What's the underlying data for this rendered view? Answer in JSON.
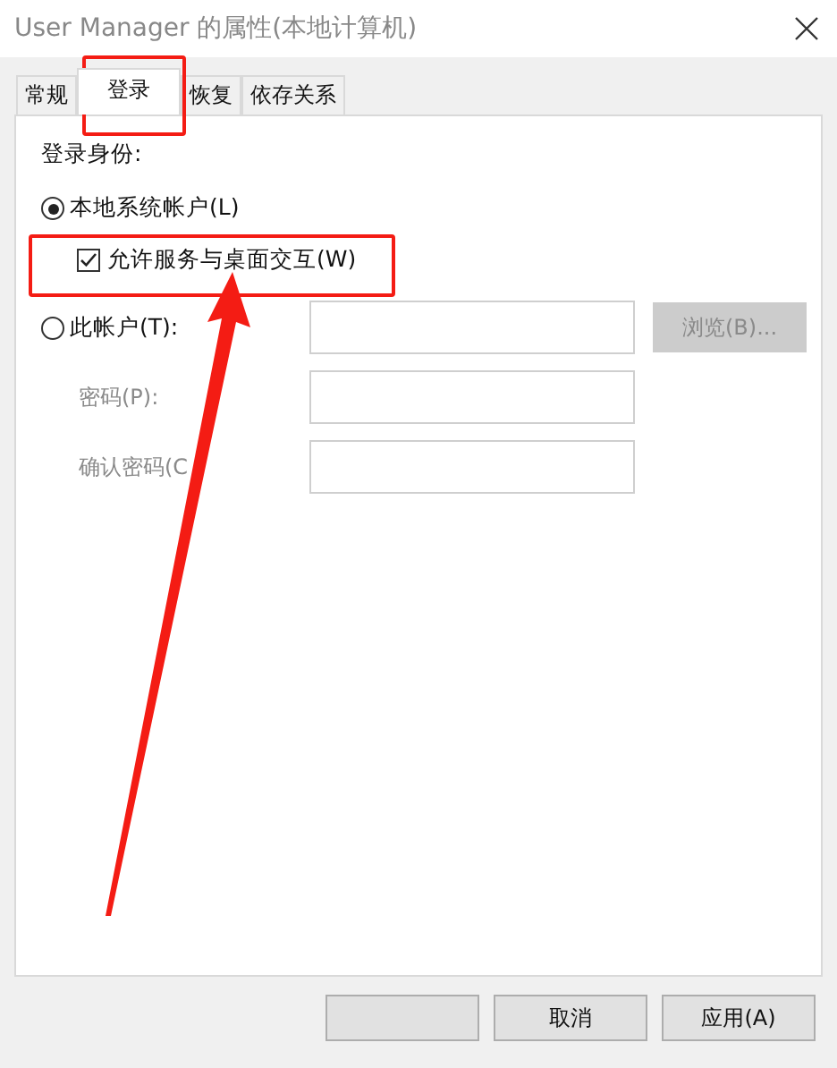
{
  "window": {
    "title": "User Manager 的属性(本地计算机)"
  },
  "tabs": [
    {
      "label": "常规",
      "selected": false
    },
    {
      "label": "登录",
      "selected": true
    },
    {
      "label": "恢复",
      "selected": false
    },
    {
      "label": "依存关系",
      "selected": false
    }
  ],
  "logon_as": {
    "label": "登录身份:",
    "local_system": {
      "label": "本地系统帐户(L)",
      "selected": true
    },
    "allow_desktop": {
      "label": "允许服务与桌面交互(W)",
      "checked": true
    },
    "this_account": {
      "label": "此帐户(T):",
      "selected": false
    },
    "browse_button": {
      "label": "浏览(B)...",
      "disabled": true
    },
    "password": {
      "label": "密码(P):",
      "disabled": true
    },
    "confirm_password": {
      "label": "确认密码(C",
      "disabled": true
    }
  },
  "buttons": [
    "取消",
    "应用(A)"
  ]
}
